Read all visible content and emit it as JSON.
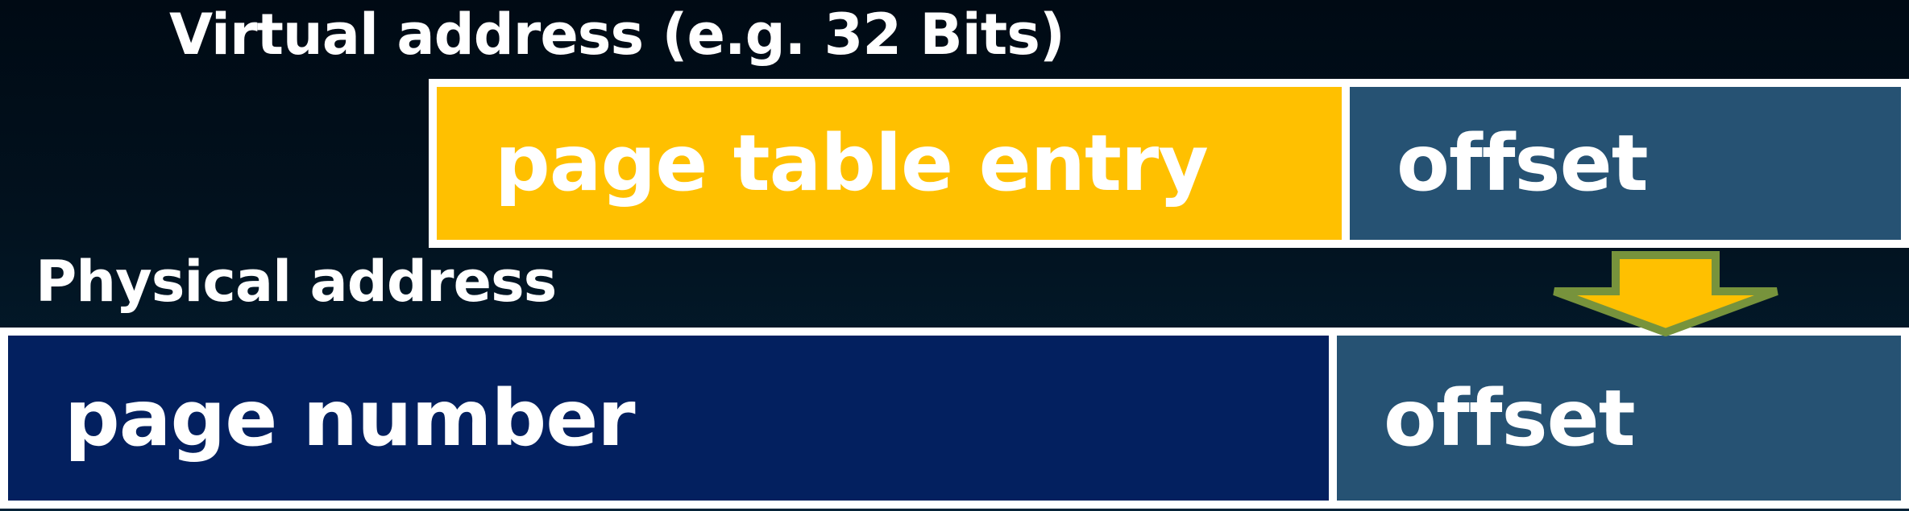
{
  "virtual_address": {
    "title": "Virtual address (e.g. 32 Bits)",
    "fields": {
      "page_table_entry": "page table entry",
      "offset": "offset"
    }
  },
  "physical_address": {
    "title": "Physical address",
    "fields": {
      "page_number": "page number",
      "offset": "offset"
    }
  },
  "colors": {
    "page_table_entry": "#ffc000",
    "offset": "#265273",
    "page_number": "#03205f",
    "arrow_fill": "#ffc000",
    "arrow_stroke": "#77933c"
  },
  "icons": {
    "offset_copy_arrow": "down-arrow-icon"
  }
}
